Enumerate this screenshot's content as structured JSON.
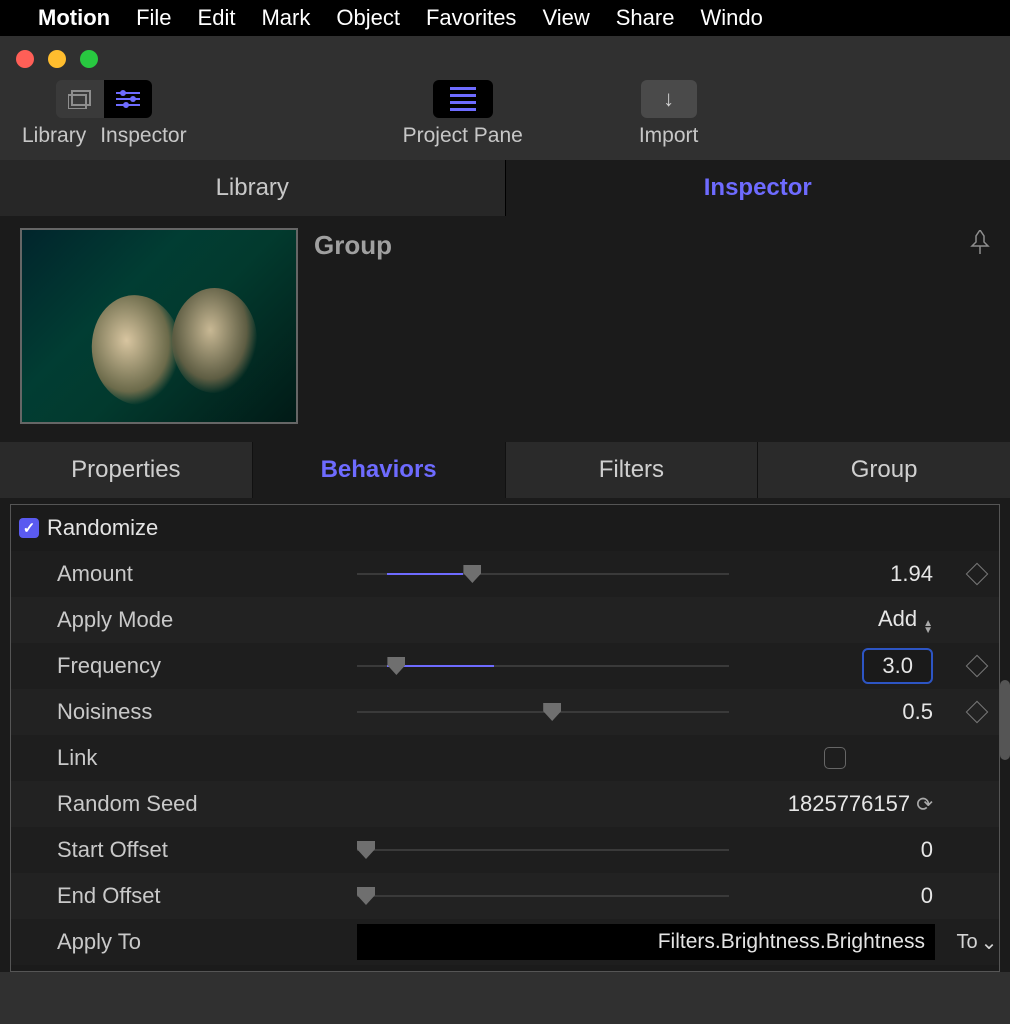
{
  "menubar": {
    "app_name": "Motion",
    "items": [
      "File",
      "Edit",
      "Mark",
      "Object",
      "Favorites",
      "View",
      "Share",
      "Windo"
    ]
  },
  "toolbar": {
    "library_label": "Library",
    "inspector_label": "Inspector",
    "project_pane_label": "Project Pane",
    "import_label": "Import"
  },
  "side_tabs": {
    "library": "Library",
    "inspector": "Inspector",
    "active": "inspector"
  },
  "group": {
    "title": "Group"
  },
  "prop_tabs": {
    "items": [
      "Properties",
      "Behaviors",
      "Filters",
      "Group"
    ],
    "active_index": 1
  },
  "behavior": {
    "section_title": "Randomize",
    "amount": {
      "label": "Amount",
      "value": "1.94",
      "fill_pct": 8,
      "fill_width_pct": 20,
      "thumb_pct": 28
    },
    "apply_mode": {
      "label": "Apply Mode",
      "value": "Add"
    },
    "frequency": {
      "label": "Frequency",
      "value": "3.0",
      "fill_left_pct": 8,
      "fill_width_pct": 28,
      "thumb_pct": 8
    },
    "noisiness": {
      "label": "Noisiness",
      "value": "0.5",
      "thumb_pct": 49
    },
    "link": {
      "label": "Link",
      "checked": false
    },
    "random_seed": {
      "label": "Random Seed",
      "value": "1825776157"
    },
    "start_offset": {
      "label": "Start Offset",
      "value": "0",
      "thumb_pct": 0
    },
    "end_offset": {
      "label": "End Offset",
      "value": "0",
      "thumb_pct": 0
    },
    "apply_to": {
      "label": "Apply To",
      "value": "Filters.Brightness.Brightness",
      "button": "To"
    }
  },
  "colors": {
    "accent": "#6e6bff"
  }
}
